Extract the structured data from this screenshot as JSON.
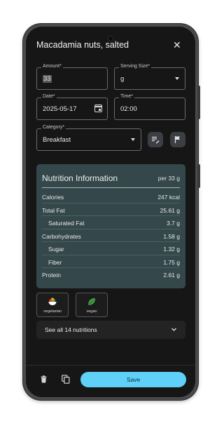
{
  "header": {
    "title": "Macadamia nuts, salted"
  },
  "form": {
    "amount": {
      "label": "Amount*",
      "value": "33"
    },
    "serving": {
      "label": "Serving Size*",
      "value": "g"
    },
    "date": {
      "label": "Date*",
      "value": "2025-05-17"
    },
    "time": {
      "label": "Time*",
      "value": "02:00"
    },
    "category": {
      "label": "Category*",
      "value": "Breakfast"
    }
  },
  "nutrition": {
    "title": "Nutrition Information",
    "per": "per 33 g",
    "rows": [
      {
        "name": "Calories",
        "value": "247 kcal"
      },
      {
        "name": "Total Fat",
        "value": "25.61 g"
      },
      {
        "name": "Saturated Fat",
        "value": "3.7 g"
      },
      {
        "name": "Carbohydrates",
        "value": "1.58 g"
      },
      {
        "name": "Sugar",
        "value": "1.32 g"
      },
      {
        "name": "Fiber",
        "value": "1.75 g"
      },
      {
        "name": "Protein",
        "value": "2.61 g"
      }
    ]
  },
  "tags": [
    {
      "label": "vegetarian",
      "icon": "salad-bowl-icon"
    },
    {
      "label": "vegan",
      "icon": "leaf-icon"
    }
  ],
  "see_all": {
    "label": "See all 14 nutritions"
  },
  "footer": {
    "save_label": "Save"
  },
  "colors": {
    "accent": "#5fd0f7",
    "panel": "#34474b",
    "background": "#161616"
  }
}
